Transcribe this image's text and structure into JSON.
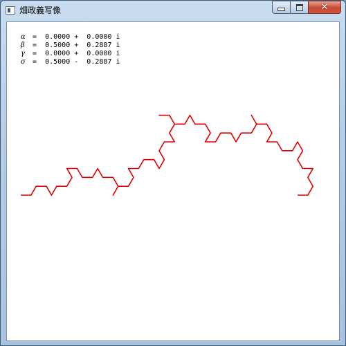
{
  "window": {
    "title": "畑政義写像"
  },
  "controls": {
    "minimize": "minimize",
    "maximize": "maximize",
    "close": "✕"
  },
  "params": [
    {
      "symbol": "α",
      "value": "=  0.0000 +  0.0000 i"
    },
    {
      "symbol": "β",
      "value": "=  0.5000 +  0.2887 i"
    },
    {
      "symbol": "γ",
      "value": "=  0.0000 +  0.0000 i"
    },
    {
      "symbol": "σ",
      "value": "=  0.5000 -  0.2887 i"
    }
  ],
  "fractal": {
    "alpha": [
      0.0,
      0.0
    ],
    "beta": [
      0.5,
      0.2887
    ],
    "gamma": [
      0.0,
      0.0
    ],
    "delta": [
      0.5,
      -0.2887
    ],
    "iterations": 6,
    "curve_color": "#e00000"
  }
}
